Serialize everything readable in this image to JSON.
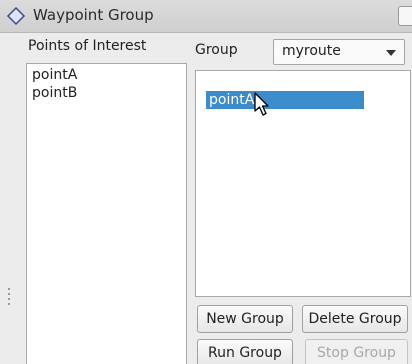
{
  "window": {
    "title": "Waypoint Group",
    "title_icon": "diamond-icon"
  },
  "poi": {
    "label": "Points of Interest",
    "items": [
      "pointA",
      "pointB"
    ]
  },
  "group": {
    "label": "Group",
    "selected": "myroute",
    "items": [
      "pointA"
    ],
    "selected_item_color": "#3c8ccc"
  },
  "buttons": {
    "new_group": "New Group",
    "delete_group": "Delete Group",
    "run_group": "Run Group",
    "stop_group": "Stop Group"
  }
}
